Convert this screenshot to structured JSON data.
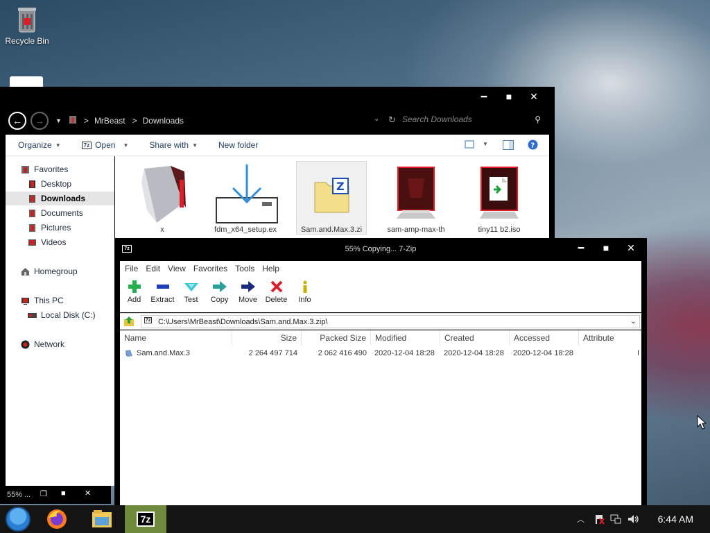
{
  "desktop": {
    "recycle_bin_label": "Recycle Bin"
  },
  "explorer": {
    "window_controls": {
      "minimize": "━",
      "maximize": "■",
      "close": "✕"
    },
    "breadcrumb": [
      "MrBeast",
      "Downloads"
    ],
    "breadcrumb_sep": ">",
    "search_placeholder": "Search Downloads",
    "toolbar": {
      "organize": "Organize",
      "open": "Open",
      "share_with": "Share with",
      "new_folder": "New folder"
    },
    "nav": {
      "favorites": "Favorites",
      "desktop": "Desktop",
      "downloads": "Downloads",
      "documents": "Documents",
      "pictures": "Pictures",
      "videos": "Videos",
      "homegroup": "Homegroup",
      "this_pc": "This PC",
      "local_disk": "Local Disk (C:)",
      "network": "Network"
    },
    "files": [
      {
        "name": "x"
      },
      {
        "name": "fdm_x64_setup.ex"
      },
      {
        "name": "Sam.and.Max.3.zi"
      },
      {
        "name": "sam-amp-max-th"
      },
      {
        "name": "tiny11 b2.iso"
      }
    ]
  },
  "minibar": {
    "label": "55% ...",
    "restore": "❐",
    "maximize": "■",
    "close": "✕"
  },
  "sevenzip": {
    "title": "55% Copying... 7-Zip",
    "logo": "7z",
    "window_controls": {
      "minimize": "━",
      "maximize": "■",
      "close": "✕"
    },
    "menu": [
      "File",
      "Edit",
      "View",
      "Favorites",
      "Tools",
      "Help"
    ],
    "toolbar": {
      "add": "Add",
      "extract": "Extract",
      "test": "Test",
      "copy": "Copy",
      "move": "Move",
      "delete": "Delete",
      "info": "Info"
    },
    "path": "C:\\Users\\MrBeast\\Downloads\\Sam.and.Max.3.zip\\",
    "columns": {
      "name": "Name",
      "size": "Size",
      "packed_size": "Packed Size",
      "modified": "Modified",
      "created": "Created",
      "accessed": "Accessed",
      "attributes": "Attribute"
    },
    "rows": [
      {
        "name": "Sam.and.Max.3",
        "size": "2 264 497 714",
        "packed_size": "2 062 416 490",
        "modified": "2020-12-04 18:28",
        "created": "2020-12-04 18:28",
        "accessed": "2020-12-04 18:28",
        "attributes": "I"
      }
    ]
  },
  "taskbar": {
    "clock": "6:44 AM",
    "active_app_label": "7z"
  },
  "colors": {
    "window_chrome": "#000000",
    "taskbar": "#141414",
    "active_task": "#6e8a3a",
    "explorer_selection": "#e5e5e5"
  }
}
